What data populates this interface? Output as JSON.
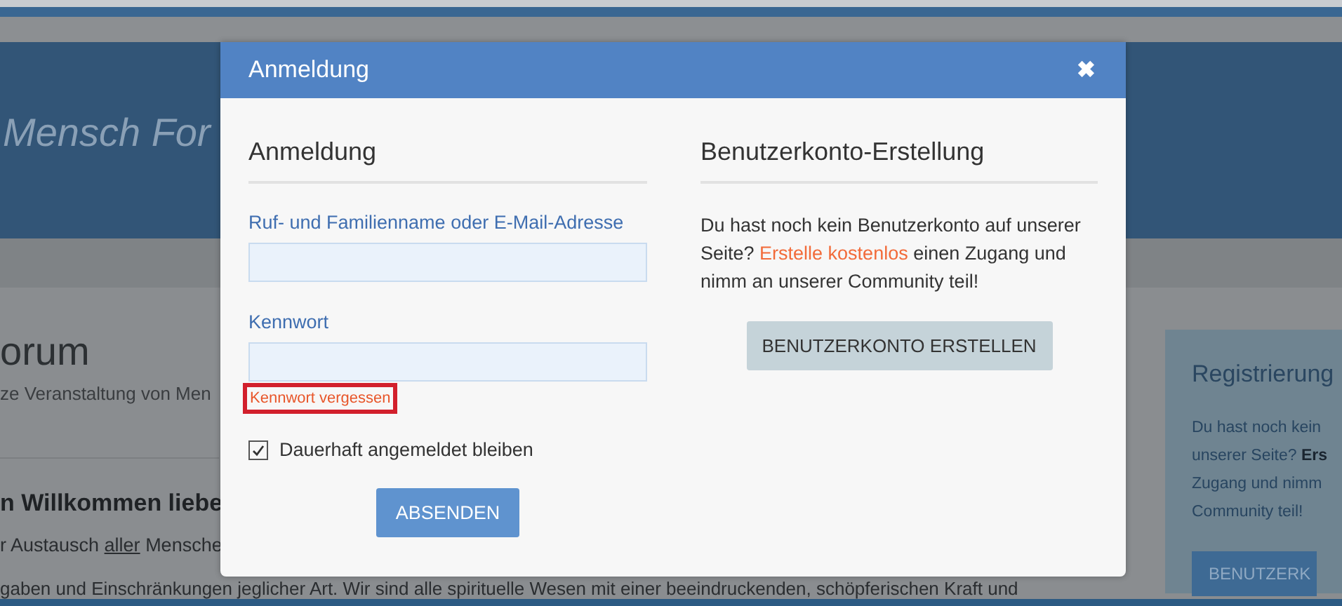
{
  "page": {
    "header_title": "Mensch For",
    "title": "orum",
    "subtitle": "ze Veranstaltung von Men",
    "welcome": "n Willkommen liebe",
    "intro": {
      "before": "r Austausch ",
      "link": "aller",
      "after": " Mensche"
    },
    "body_line": "gaben und Einschränkungen jeglicher Art. Wir sind alle spirituelle Wesen mit einer beeindruckenden, schöpferischen Kraft und"
  },
  "side_panel": {
    "title": "Registrierung",
    "lines": [
      "Du hast noch kein",
      "unserer Seite? **Ers**",
      "Zugang und nimm",
      "Community teil!"
    ],
    "button": "BENUTZERK"
  },
  "modal": {
    "title": "Anmeldung",
    "close": "✖",
    "login": {
      "heading": "Anmeldung",
      "fields": [
        {
          "label": "Ruf- und Familienname oder E-Mail-Adresse"
        },
        {
          "label": "Kennwort"
        }
      ],
      "forgot_link": "Kennwort vergessen",
      "forgot_highlighted": true,
      "remember": {
        "label": "Dauerhaft angemeldet bleiben",
        "checked": true
      },
      "submit": "ABSENDEN"
    },
    "register": {
      "heading": "Benutzerkonto-Erstellung",
      "text_before": "Du hast noch kein Benutzerkonto auf unserer Seite? ",
      "link": "Erstelle kostenlos",
      "text_after": " einen Zugang und nimm an unserer Community teil!",
      "button": "BENUTZERKONTO ERSTELLEN"
    }
  }
}
